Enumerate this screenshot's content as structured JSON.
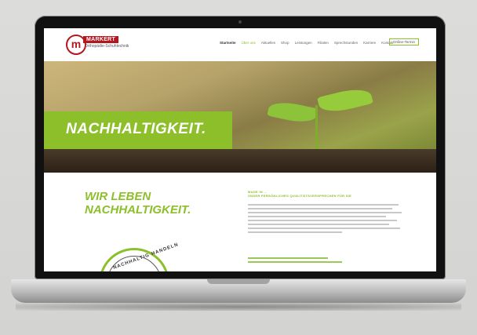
{
  "website": {
    "logo": {
      "mark": "m",
      "brand": "MARKERT",
      "subtitle": "Orthopädie-Schuhtechnik"
    },
    "nav_items": [
      {
        "label": "Startseite",
        "state": "active"
      },
      {
        "label": "Über uns",
        "state": "green"
      },
      {
        "label": "Aktuelles",
        "state": "normal"
      },
      {
        "label": "Shop",
        "state": "normal"
      },
      {
        "label": "Leistungen",
        "state": "normal"
      },
      {
        "label": "Filialen",
        "state": "normal"
      },
      {
        "label": "Sprechstunden",
        "state": "normal"
      },
      {
        "label": "Karriere",
        "state": "normal"
      },
      {
        "label": "Kontakt",
        "state": "normal"
      }
    ],
    "contact_button": "Online-Termin",
    "hero_title": "NACHHALTIGKEIT.",
    "claim": "WIR LEBEN NACHHALTIGKEIT.",
    "kicker": "MADE IN ...\nUNSER PERSÖNLICHES QUALITÄTSVERSPRECHEN FÜR SIE",
    "stamp_text": "NACHHALTIG HANDELN"
  },
  "colors": {
    "brand_red": "#b5171e",
    "accent_green": "#8cbf2a"
  }
}
